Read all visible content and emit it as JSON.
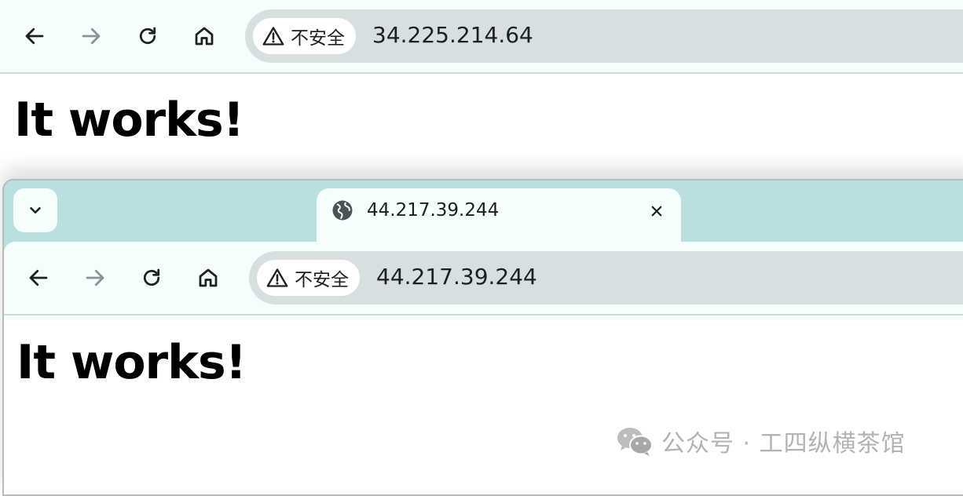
{
  "window_back": {
    "security_chip_label": "不安全",
    "url": "34.225.214.64",
    "page_heading": "It works!"
  },
  "window_front": {
    "tab_title": "44.217.39.244",
    "security_chip_label": "不安全",
    "url": "44.217.39.244",
    "page_heading": "It works!"
  },
  "watermark": {
    "text": "公众号 · 工四纵横茶馆"
  },
  "icons": {
    "back": "arrow-left-icon",
    "forward": "arrow-right-icon",
    "reload": "reload-icon",
    "home": "home-icon",
    "security": "warning-triangle-icon",
    "tab_favicon": "globe-icon",
    "tab_close": "close-icon",
    "tab_search": "chevron-down-icon",
    "watermark_logo": "wechat-icon"
  },
  "colors": {
    "toolbar_bg": "#f4fefd",
    "tabstrip_bg": "#b9dfe0",
    "omnibox_bg": "#d7e0e0",
    "forward_disabled": "#8a9494"
  }
}
